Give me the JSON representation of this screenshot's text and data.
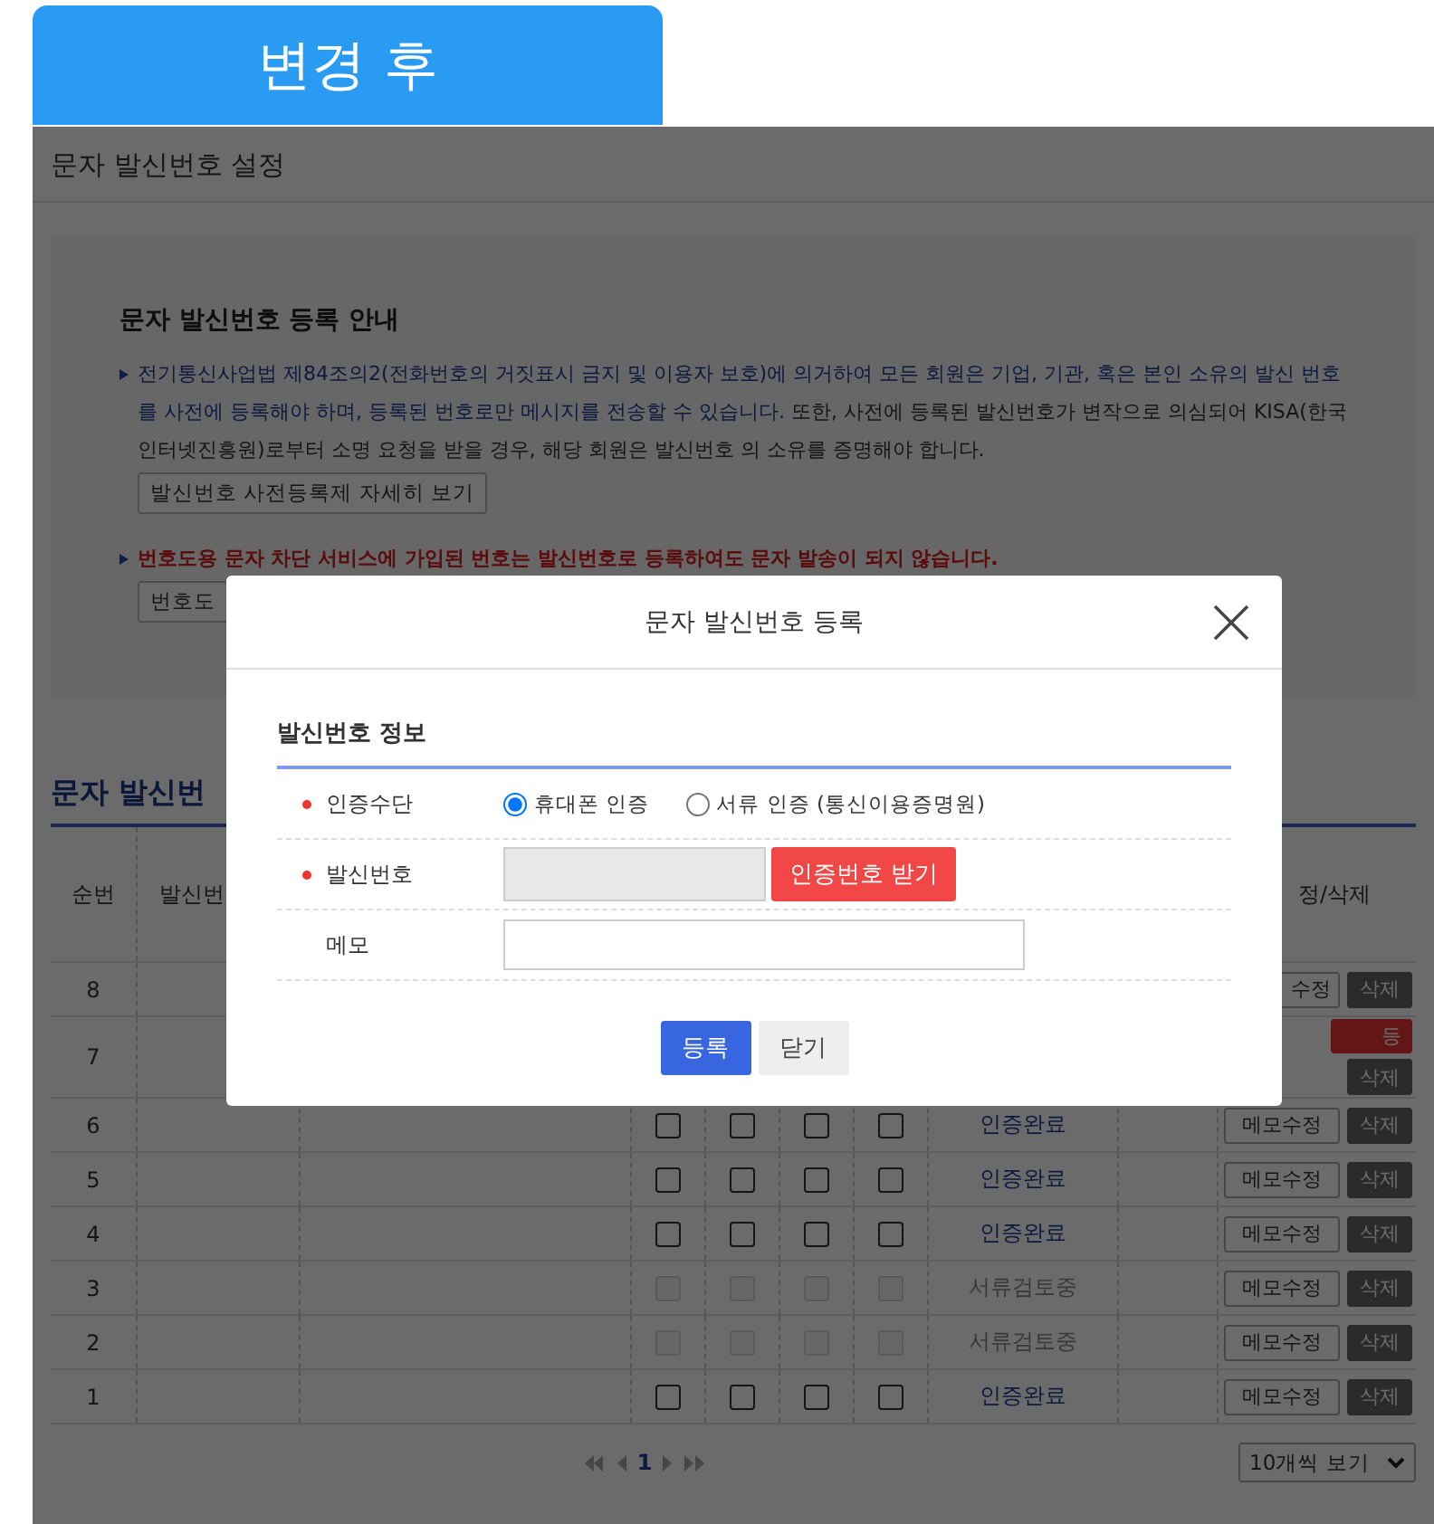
{
  "tab": {
    "label": "변경 후"
  },
  "page": {
    "title": "문자 발신번호 설정",
    "guide": {
      "heading": "문자 발신번호 등록 안내",
      "notice_blue": "전기통신사업법 제84조의2(전화번호의 거짓표시 금지 및 이용자 보호)에 의거하여 모든 회원은 기업, 기관, 혹은 본인 소유의 발신 번호를 사전에 등록해야 하며, 등록된 번호로만 메시지를 전송할 수 있습니다.",
      "notice_dark": "또한, 사전에 등록된 발신번호가 변작으로 의심되어 KISA(한국인터넷진흥원)로부터 소명 요청을 받을 경우, 해당 회원은 발신번호 의 소유를 증명해야 합니다.",
      "detail_button": "발신번호 사전등록제 자세히 보기",
      "warning": "번호도용 문자 차단 서비스에 가입된 번호는 발신번호로 등록하여도 문자 발송이 되지 않습니다.",
      "block_button": "번호도"
    },
    "list_heading": "문자 발신번",
    "table": {
      "columns": [
        {
          "label": "순번"
        },
        {
          "label": "발신번"
        },
        {
          "label": "정/삭제"
        }
      ],
      "rows": [
        {
          "kind": "partial",
          "no": "8",
          "memo_button": "수정",
          "delete_button": "삭제"
        },
        {
          "kind": "partial",
          "no": "7",
          "extra_button": "등",
          "delete_button": "삭제"
        },
        {
          "kind": "full",
          "no": "6",
          "disabled": false,
          "checks": [
            false,
            false,
            false,
            false
          ],
          "status": "인증완료",
          "memo_button": "메모수정",
          "delete_button": "삭제"
        },
        {
          "kind": "full",
          "no": "5",
          "disabled": false,
          "checks": [
            false,
            false,
            false,
            false
          ],
          "status": "인증완료",
          "memo_button": "메모수정",
          "delete_button": "삭제"
        },
        {
          "kind": "full",
          "no": "4",
          "disabled": false,
          "checks": [
            false,
            false,
            false,
            false
          ],
          "status": "인증완료",
          "memo_button": "메모수정",
          "delete_button": "삭제"
        },
        {
          "kind": "full",
          "no": "3",
          "disabled": true,
          "checks": [
            false,
            false,
            false,
            false
          ],
          "status": "서류검토중",
          "memo_button": "메모수정",
          "delete_button": "삭제"
        },
        {
          "kind": "full",
          "no": "2",
          "disabled": true,
          "checks": [
            false,
            false,
            false,
            false
          ],
          "status": "서류검토중",
          "memo_button": "메모수정",
          "delete_button": "삭제"
        },
        {
          "kind": "full",
          "no": "1",
          "disabled": false,
          "checks": [
            false,
            false,
            false,
            false
          ],
          "status": "인증완료",
          "memo_button": "메모수정",
          "delete_button": "삭제"
        }
      ]
    },
    "pagination": {
      "current": "1"
    },
    "page_size": "10개씩 보기"
  },
  "dialog": {
    "title": "문자 발신번호 등록",
    "section": "발신번호 정보",
    "method": {
      "label": "인증수단",
      "required": true,
      "options": [
        {
          "label": "휴대폰 인증",
          "selected": true
        },
        {
          "label": "서류 인증 (통신이용증명원)",
          "selected": false
        }
      ]
    },
    "number": {
      "label": "발신번호",
      "required": true,
      "button": "인증번호 받기"
    },
    "memo": {
      "label": "메모",
      "required": false
    },
    "buttons": [
      {
        "kind": "primary",
        "label": "등록"
      },
      {
        "kind": "secondary",
        "label": "닫기"
      }
    ]
  }
}
